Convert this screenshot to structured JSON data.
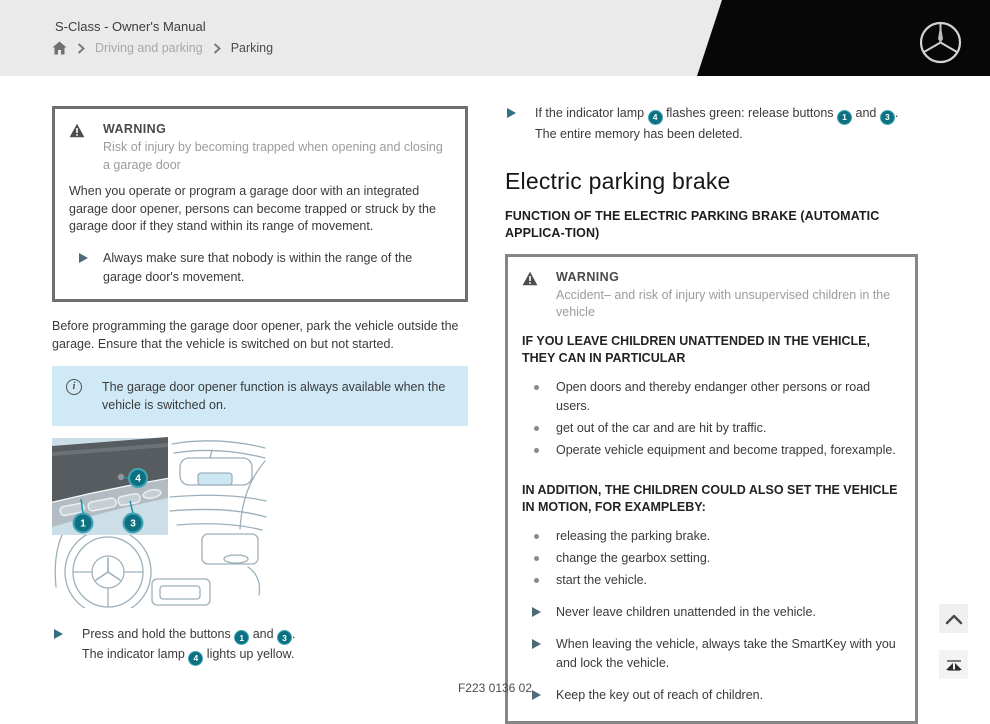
{
  "header": {
    "title": "S-Class - Owner's Manual",
    "breadcrumb": {
      "parent": "Driving and parking",
      "current": "Parking"
    }
  },
  "badges": {
    "n1": "1",
    "n3": "3",
    "n4": "4"
  },
  "left": {
    "warning": {
      "label": "WARNING",
      "subtitle": "Risk of injury by becoming trapped when opening and closing a garage door",
      "body": "When you operate or program a garage door with an integrated garage door opener, persons can become trapped or struck by the garage door if they stand within its range of movement.",
      "action": "Always make sure that nobody is within the range of the garage door's movement."
    },
    "para": "Before programming the garage door opener, park the vehicle outside the garage. Ensure that the vehicle is switched on but not started.",
    "info_note": "The garage door opener function is always available when the vehicle is switched on.",
    "instruction": {
      "line1_pre": "Press and hold the buttons",
      "and": "and",
      "period": ".",
      "line2_pre": "The indicator lamp",
      "line2_post": "lights up yellow."
    }
  },
  "right": {
    "instruction": {
      "line1_pre": "If the indicator lamp",
      "line1_mid": "flashes green: release buttons",
      "and": "and",
      "period": ".",
      "line2": "The entire memory has been deleted."
    },
    "heading": "Electric parking brake",
    "subheading": "FUNCTION OF THE ELECTRIC PARKING BRAKE (AUTOMATIC APPLICA‐TION)",
    "warning": {
      "label": "WARNING",
      "subtitle": "Accident– and risk of injury with unsupervised children in the vehicle",
      "lead1": "IF YOU LEAVE CHILDREN UNATTENDED IN THE VEHICLE, THEY CAN IN PARTICULAR",
      "bullets1": [
        "Open doors and thereby endanger other persons or road users.",
        "get out of the car and are hit by traffic.",
        "Operate vehicle equipment and become trapped, forexample."
      ],
      "lead2": "IN ADDITION, THE CHILDREN COULD ALSO SET THE VEHICLE IN MOTION, FOR EXAMPLEBY:",
      "bullets2": [
        "releasing the parking brake.",
        "change the gearbox setting.",
        "start the vehicle."
      ],
      "actions": [
        "Never leave children unattended in the vehicle.",
        "When leaving the vehicle, always take the SmartKey with you and lock the vehicle.",
        "Keep the key out of reach of children."
      ]
    }
  },
  "figure_caption": "F223 0136 02",
  "icons": {
    "home": "home-icon",
    "chevron_right": "chevron-right-icon",
    "mercedes_star": "mercedes-logo-icon",
    "warning_triangle": "warning-triangle-icon",
    "info": "info-icon",
    "chevron_up": "chevron-up-icon",
    "broken_image": "broken-image-icon"
  },
  "colors": {
    "accent_teal": "#0e7181",
    "teal_ring": "#43a6b6",
    "info_bg": "#cfe9f7",
    "header_bg": "#eaeaea",
    "header_black": "#070707",
    "warning_border": "#6f6f6f"
  }
}
